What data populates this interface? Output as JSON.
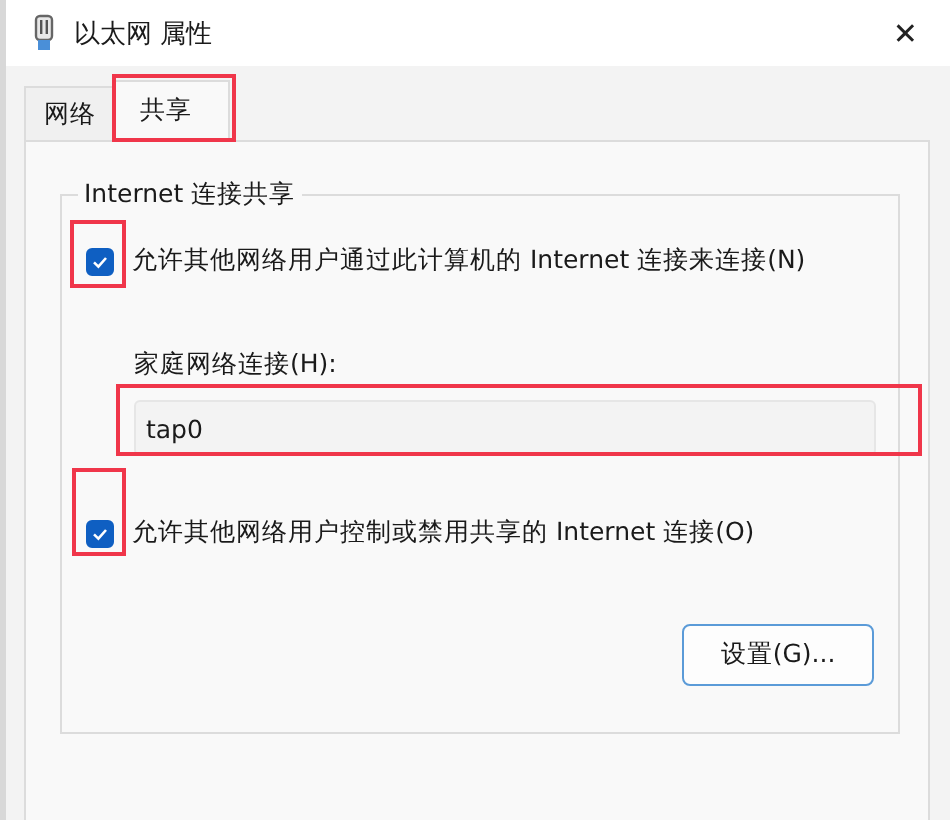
{
  "window": {
    "title": "以太网 属性",
    "close": "✕"
  },
  "tabs": [
    {
      "label": "网络",
      "selected": false,
      "highlighted": false
    },
    {
      "label": "共享",
      "selected": true,
      "highlighted": true
    }
  ],
  "group": {
    "title": "Internet 连接共享",
    "allow_sharing": {
      "label": "允许其他网络用户通过此计算机的 Internet 连接来连接(N)",
      "checked": true,
      "highlighted": true
    },
    "home_network": {
      "label": "家庭网络连接(H):",
      "value": "tap0",
      "highlighted": true
    },
    "allow_control": {
      "label": "允许其他网络用户控制或禁用共享的 Internet 连接(O)",
      "checked": true,
      "highlighted": true
    },
    "settings_button": "设置(G)..."
  }
}
